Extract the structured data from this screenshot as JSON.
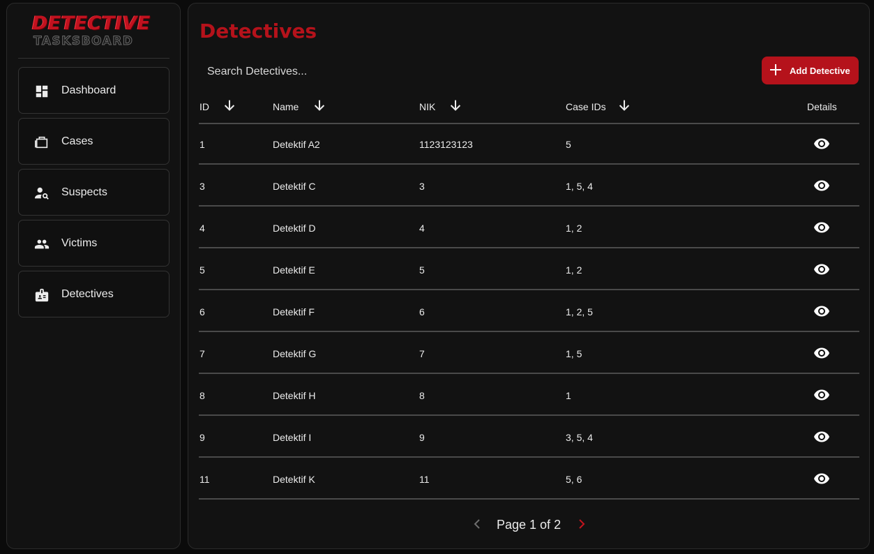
{
  "sidebar": {
    "logo_line1": "DETECTIVE",
    "logo_line2": "TASKSBOARD",
    "items": [
      {
        "label": "Dashboard",
        "icon": "dashboard-icon"
      },
      {
        "label": "Cases",
        "icon": "briefcase-icon"
      },
      {
        "label": "Suspects",
        "icon": "person-search-icon"
      },
      {
        "label": "Victims",
        "icon": "people-icon"
      },
      {
        "label": "Detectives",
        "icon": "badge-icon"
      }
    ]
  },
  "main": {
    "title": "Detectives",
    "search_placeholder": "Search Detectives...",
    "add_button_label": "Add Detective",
    "columns": {
      "id": "ID",
      "name": "Name",
      "nik": "NIK",
      "case_ids": "Case IDs",
      "details": "Details"
    },
    "rows": [
      {
        "id": "1",
        "name": "Detektif A2",
        "nik": "1123123123",
        "case_ids": "5"
      },
      {
        "id": "3",
        "name": "Detektif C",
        "nik": "3",
        "case_ids": "1, 5, 4"
      },
      {
        "id": "4",
        "name": "Detektif D",
        "nik": "4",
        "case_ids": "1, 2"
      },
      {
        "id": "5",
        "name": "Detektif E",
        "nik": "5",
        "case_ids": "1, 2"
      },
      {
        "id": "6",
        "name": "Detektif F",
        "nik": "6",
        "case_ids": "1, 2, 5"
      },
      {
        "id": "7",
        "name": "Detektif G",
        "nik": "7",
        "case_ids": "1, 5"
      },
      {
        "id": "8",
        "name": "Detektif H",
        "nik": "8",
        "case_ids": "1"
      },
      {
        "id": "9",
        "name": "Detektif I",
        "nik": "9",
        "case_ids": "3, 5, 4"
      },
      {
        "id": "11",
        "name": "Detektif K",
        "nik": "11",
        "case_ids": "5, 6"
      }
    ],
    "pagination": {
      "text": "Page 1 of 2",
      "current": 1,
      "total": 2
    }
  },
  "colors": {
    "accent": "#b5121b",
    "background": "#121212",
    "divider": "#4a4a4a"
  }
}
